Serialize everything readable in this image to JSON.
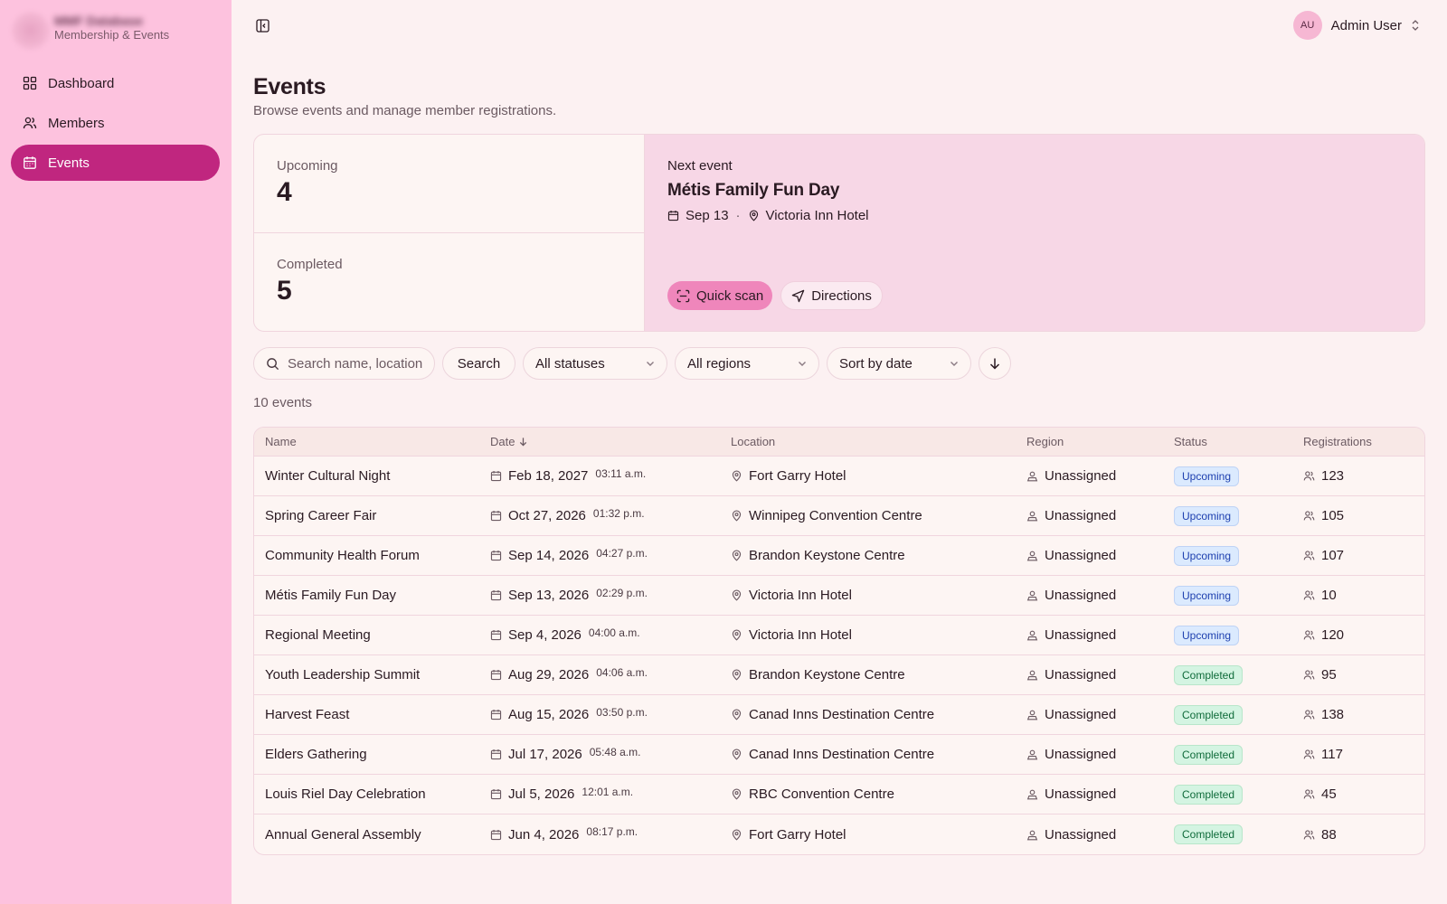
{
  "brand": {
    "name": "MMF Database",
    "subtitle": "Membership & Events"
  },
  "sidebar": {
    "items": [
      {
        "label": "Dashboard",
        "icon": "grid-icon"
      },
      {
        "label": "Members",
        "icon": "users-icon"
      },
      {
        "label": "Events",
        "icon": "calendar-icon",
        "active": true
      }
    ]
  },
  "header": {
    "avatar_initials": "AU",
    "user_name": "Admin User"
  },
  "page": {
    "title": "Events",
    "subtitle": "Browse events and manage member registrations."
  },
  "summary": {
    "upcoming_label": "Upcoming",
    "upcoming_value": "4",
    "completed_label": "Completed",
    "completed_value": "5",
    "next_label": "Next event",
    "next_title": "Métis Family Fun Day",
    "next_date": "Sep 13",
    "next_separator": "·",
    "next_location": "Victoria Inn Hotel",
    "quick_scan_label": "Quick scan",
    "directions_label": "Directions"
  },
  "filters": {
    "search_placeholder": "Search name, location",
    "search_button": "Search",
    "status_select": "All statuses",
    "region_select": "All regions",
    "sort_select": "Sort by date"
  },
  "results_count": "10 events",
  "table": {
    "columns": [
      "Name",
      "Date",
      "Location",
      "Region",
      "Status",
      "Registrations"
    ],
    "rows": [
      {
        "name": "Winter Cultural Night",
        "date": "Feb 18, 2027",
        "time": "03:11 a.m.",
        "location": "Fort Garry Hotel",
        "region": "Unassigned",
        "status": "Upcoming",
        "registrations": "123"
      },
      {
        "name": "Spring Career Fair",
        "date": "Oct 27, 2026",
        "time": "01:32 p.m.",
        "location": "Winnipeg Convention Centre",
        "region": "Unassigned",
        "status": "Upcoming",
        "registrations": "105"
      },
      {
        "name": "Community Health Forum",
        "date": "Sep 14, 2026",
        "time": "04:27 p.m.",
        "location": "Brandon Keystone Centre",
        "region": "Unassigned",
        "status": "Upcoming",
        "registrations": "107"
      },
      {
        "name": "Métis Family Fun Day",
        "date": "Sep 13, 2026",
        "time": "02:29 p.m.",
        "location": "Victoria Inn Hotel",
        "region": "Unassigned",
        "status": "Upcoming",
        "registrations": "10"
      },
      {
        "name": "Regional Meeting",
        "date": "Sep 4, 2026",
        "time": "04:00 a.m.",
        "location": "Victoria Inn Hotel",
        "region": "Unassigned",
        "status": "Upcoming",
        "registrations": "120"
      },
      {
        "name": "Youth Leadership Summit",
        "date": "Aug 29, 2026",
        "time": "04:06 a.m.",
        "location": "Brandon Keystone Centre",
        "region": "Unassigned",
        "status": "Completed",
        "registrations": "95"
      },
      {
        "name": "Harvest Feast",
        "date": "Aug 15, 2026",
        "time": "03:50 p.m.",
        "location": "Canad Inns Destination Centre",
        "region": "Unassigned",
        "status": "Completed",
        "registrations": "138"
      },
      {
        "name": "Elders Gathering",
        "date": "Jul 17, 2026",
        "time": "05:48 a.m.",
        "location": "Canad Inns Destination Centre",
        "region": "Unassigned",
        "status": "Completed",
        "registrations": "117"
      },
      {
        "name": "Louis Riel Day Celebration",
        "date": "Jul 5, 2026",
        "time": "12:01 a.m.",
        "location": "RBC Convention Centre",
        "region": "Unassigned",
        "status": "Completed",
        "registrations": "45"
      },
      {
        "name": "Annual General Assembly",
        "date": "Jun 4, 2026",
        "time": "08:17 p.m.",
        "location": "Fort Garry Hotel",
        "region": "Unassigned",
        "status": "Completed",
        "registrations": "88"
      }
    ]
  },
  "colors": {
    "accent": "#c0267f",
    "sidebar_bg": "#fdc2de",
    "page_bg": "#fcf1f2",
    "upcoming_badge": "#dbeafe",
    "completed_badge": "#d4f4e2"
  }
}
